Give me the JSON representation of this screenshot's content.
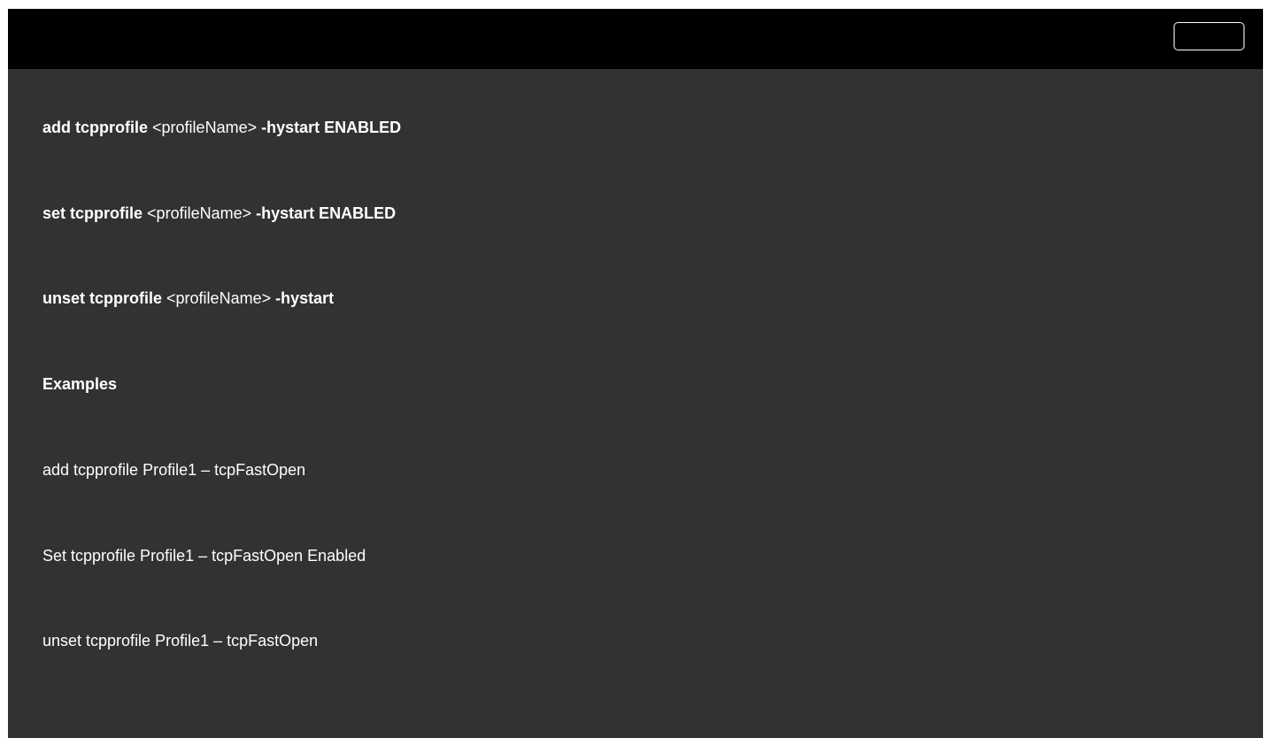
{
  "header": {
    "button_label": ""
  },
  "commands": [
    {
      "cmd": "add tcpprofile",
      "arg": "<profileName>",
      "opt": "-hystart ENABLED"
    },
    {
      "cmd": "set tcpprofile",
      "arg": "<profileName>",
      "opt": "-hystart ENABLED"
    },
    {
      "cmd": "unset tcpprofile",
      "arg": "<profileName>",
      "opt": "-hystart"
    }
  ],
  "examples_heading": "Examples",
  "examples": [
    "add tcpprofile Profile1 – tcpFastOpen",
    "Set tcpprofile Profile1 – tcpFastOpen Enabled",
    "unset tcpprofile Profile1 – tcpFastOpen"
  ],
  "colors": {
    "background": "#323232",
    "header": "#000000",
    "text": "#ffffff"
  }
}
